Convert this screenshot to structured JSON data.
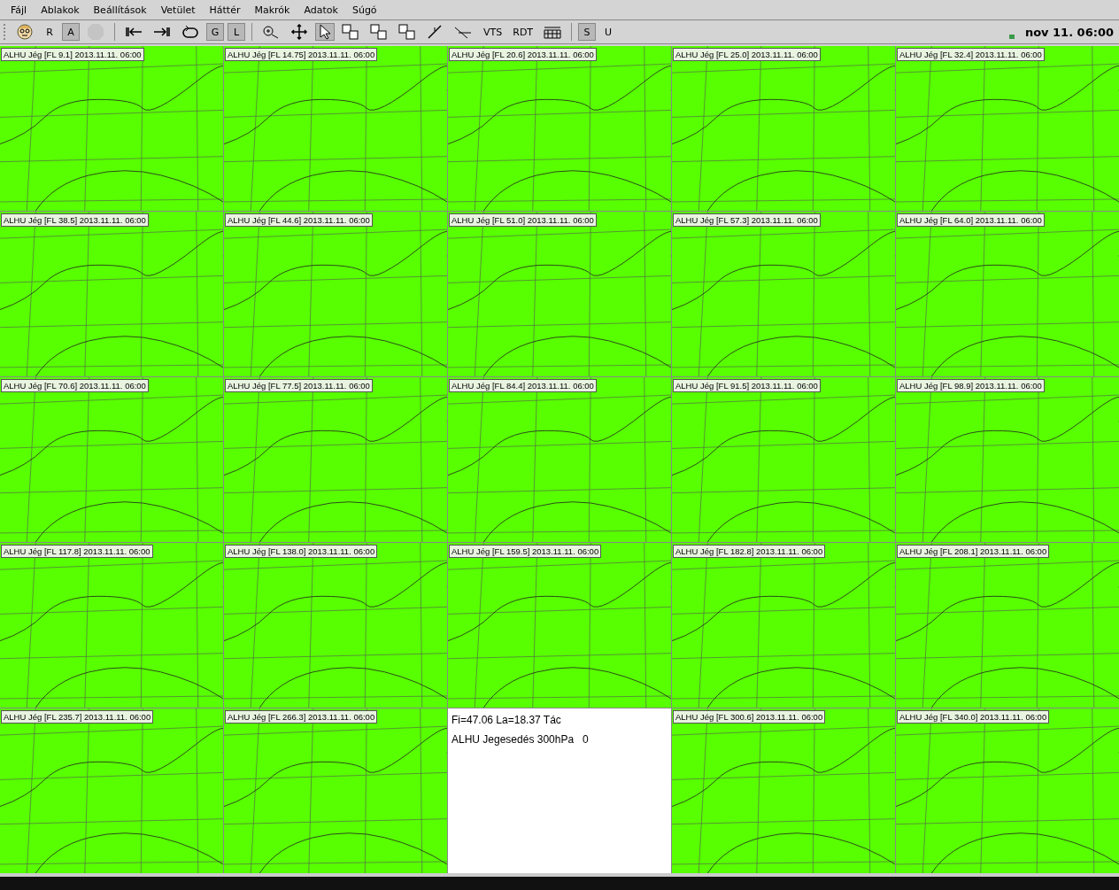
{
  "menu": [
    "Fájl",
    "Ablakok",
    "Beállítások",
    "Vetület",
    "Háttér",
    "Makrók",
    "Adatok",
    "Súgó"
  ],
  "toolbar": [
    {
      "kind": "icon",
      "selected": false
    },
    {
      "kind": "text",
      "label": "R",
      "selected": false
    },
    {
      "kind": "text",
      "label": "A",
      "selected": true
    },
    {
      "kind": "icon",
      "selected": false,
      "disabled": true
    },
    {
      "kind": "sep"
    },
    {
      "kind": "icon",
      "selected": false
    },
    {
      "kind": "icon",
      "selected": false
    },
    {
      "kind": "icon",
      "selected": false
    },
    {
      "kind": "text",
      "label": "G",
      "selected": true
    },
    {
      "kind": "text",
      "label": "L",
      "selected": true
    },
    {
      "kind": "sep"
    },
    {
      "kind": "icon",
      "selected": false
    },
    {
      "kind": "icon",
      "selected": false
    },
    {
      "kind": "icon",
      "selected": true
    },
    {
      "kind": "icon",
      "selected": false
    },
    {
      "kind": "icon",
      "selected": false
    },
    {
      "kind": "icon",
      "selected": false
    },
    {
      "kind": "icon",
      "selected": false
    },
    {
      "kind": "icon",
      "selected": false
    },
    {
      "kind": "text",
      "label": "VTS",
      "selected": false
    },
    {
      "kind": "text",
      "label": "RDT",
      "selected": false
    },
    {
      "kind": "icon",
      "selected": false
    },
    {
      "kind": "sep"
    },
    {
      "kind": "text",
      "label": "S",
      "selected": true
    },
    {
      "kind": "text",
      "label": "U",
      "selected": false
    }
  ],
  "clock": "nov 11. 06:00",
  "panels": [
    {
      "kind": "map",
      "label": "ALHU Jég [FL 9.1] 2013.11.11. 06:00"
    },
    {
      "kind": "map",
      "label": "ALHU Jég [FL 14.75] 2013.11.11. 06:00"
    },
    {
      "kind": "map",
      "label": "ALHU Jég [FL 20.6] 2013.11.11. 06:00"
    },
    {
      "kind": "map",
      "label": "ALHU Jég [FL 25.0] 2013.11.11. 06:00"
    },
    {
      "kind": "map",
      "label": "ALHU Jég [FL 32.4] 2013.11.11. 06:00"
    },
    {
      "kind": "map",
      "label": "ALHU Jég [FL 38.5] 2013.11.11. 06:00"
    },
    {
      "kind": "map",
      "label": "ALHU Jég [FL 44.6] 2013.11.11. 06:00"
    },
    {
      "kind": "map",
      "label": "ALHU Jég [FL 51.0] 2013.11.11. 06:00"
    },
    {
      "kind": "map",
      "label": "ALHU Jég [FL 57.3] 2013.11.11. 06:00"
    },
    {
      "kind": "map",
      "label": "ALHU Jég [FL 64.0] 2013.11.11. 06:00"
    },
    {
      "kind": "map",
      "label": "ALHU Jég [FL 70.6] 2013.11.11. 06:00"
    },
    {
      "kind": "map",
      "label": "ALHU Jég [FL 77.5] 2013.11.11. 06:00"
    },
    {
      "kind": "map",
      "label": "ALHU Jég [FL 84.4] 2013.11.11. 06:00"
    },
    {
      "kind": "map",
      "label": "ALHU Jég [FL 91.5] 2013.11.11. 06:00"
    },
    {
      "kind": "map",
      "label": "ALHU Jég [FL 98.9] 2013.11.11. 06:00"
    },
    {
      "kind": "map",
      "label": "ALHU Jég [FL 117.8] 2013.11.11. 06:00"
    },
    {
      "kind": "map",
      "label": "ALHU Jég [FL 138.0] 2013.11.11. 06:00"
    },
    {
      "kind": "map",
      "label": "ALHU Jég [FL 159.5] 2013.11.11. 06:00"
    },
    {
      "kind": "map",
      "label": "ALHU Jég [FL 182.8] 2013.11.11. 06:00"
    },
    {
      "kind": "map",
      "label": "ALHU Jég [FL 208.1] 2013.11.11. 06:00"
    },
    {
      "kind": "map",
      "label": "ALHU Jég [FL 235.7] 2013.11.11. 06:00"
    },
    {
      "kind": "map",
      "label": "ALHU Jég [FL 266.3] 2013.11.11. 06:00"
    },
    {
      "kind": "info",
      "lines": [
        "Fi=47.06 La=18.37 Tác",
        "ALHU Jegesedés 300hPa   0"
      ]
    },
    {
      "kind": "map",
      "label": "ALHU Jég [FL 300.6] 2013.11.11. 06:00"
    },
    {
      "kind": "map",
      "label": "ALHU Jég [FL 340.0] 2013.11.11. 06:00"
    }
  ]
}
